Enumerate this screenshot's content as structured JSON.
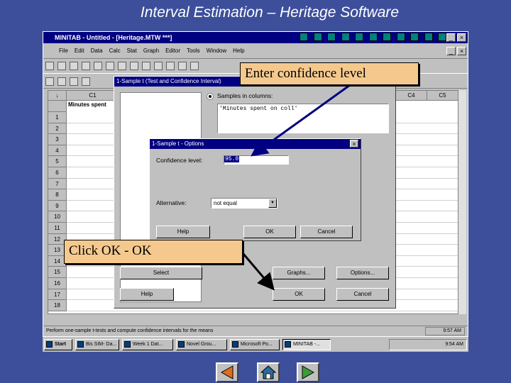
{
  "slide_title": "Interval Estimation – Heritage Software",
  "window": {
    "title": "MINITAB - Untitled - [Heritage.MTW ***]",
    "menu": [
      "File",
      "Edit",
      "Data",
      "Calc",
      "Stat",
      "Graph",
      "Editor",
      "Tools",
      "Window",
      "Help"
    ],
    "status_text": "Perform one-sample t-tests and compute confidence intervals for the means",
    "status_time": "9:57 AM"
  },
  "worksheet": {
    "columns": [
      "C1",
      "C4",
      "C5"
    ],
    "c1_name": "Minutes spent",
    "rows": [
      "1",
      "2",
      "3",
      "4",
      "5",
      "6",
      "7",
      "8",
      "9",
      "10",
      "11",
      "12",
      "13",
      "14",
      "15",
      "16",
      "17",
      "18"
    ]
  },
  "main_dialog": {
    "title": "1-Sample t (Test and Confidence Interval)",
    "samples_label": "Samples in columns:",
    "samples_value": "'Minutes spent on coll'",
    "select_label": "Select",
    "graphs_label": "Graphs...",
    "options_label": "Options...",
    "help_label": "Help",
    "ok_label": "OK",
    "cancel_label": "Cancel"
  },
  "options_dialog": {
    "title": "1-Sample t - Options",
    "confidence_label": "Confidence level:",
    "confidence_value": "95.0",
    "alternative_label": "Alternative:",
    "alternative_value": "not equal",
    "help_label": "Help",
    "ok_label": "OK",
    "cancel_label": "Cancel"
  },
  "callouts": {
    "confidence": "Enter confidence level",
    "click_ok": "Click OK - OK"
  },
  "taskbar": {
    "start": "Start",
    "items": [
      "Bis SIM- Da...",
      "Week 1 Dat...",
      "Novel Grou...",
      "Microsoft Po...",
      "MINITAB -..."
    ],
    "clock": "9:54 AM"
  },
  "colors": {
    "background": "#3d4f9a",
    "titlebar": "#000080",
    "callout": "#f5c98e"
  }
}
